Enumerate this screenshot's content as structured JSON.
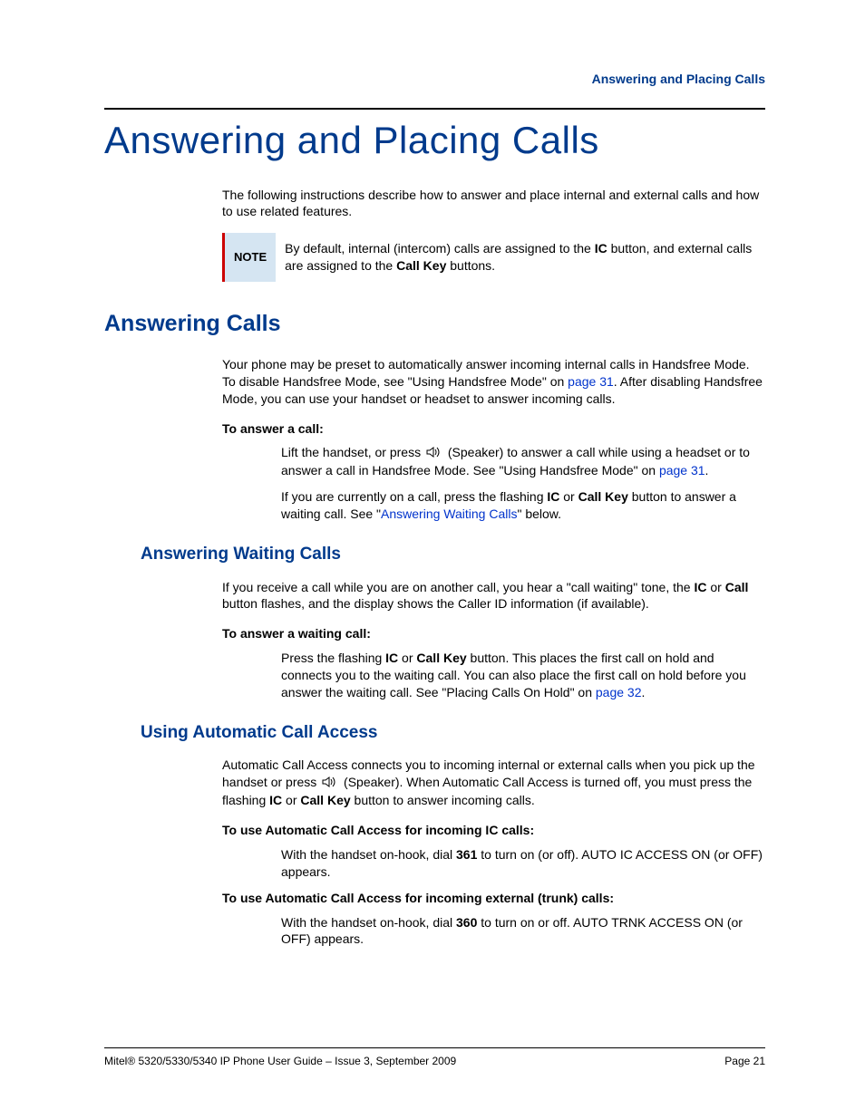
{
  "header": {
    "running": "Answering and Placing Calls"
  },
  "chapter": "Answering and Placing Calls",
  "intro": "The following instructions describe how to answer and place internal and external calls and how to use related features.",
  "note": {
    "label": "NOTE",
    "pre": "By default, internal (intercom) calls are assigned to the ",
    "b1": "IC",
    "mid": " button, and external calls are assigned to the ",
    "b2": "Call Key",
    "post": " buttons."
  },
  "s1": {
    "title": "Answering Calls",
    "p1a": "Your phone may be preset to automatically answer incoming internal calls in Handsfree Mode. To disable Handsfree Mode, see \"Using Handsfree Mode\" on ",
    "p1link": "page 31",
    "p1b": ". After disabling Handsfree Mode, you can use your handset or headset to answer incoming calls.",
    "sub": "To answer a call:",
    "l1a": "Lift the handset, or press ",
    "l1b": " (Speaker) to answer a call while using a headset or to answer a call in Handsfree Mode. See \"Using Handsfree Mode\" on ",
    "l1link": "page 31",
    "l1c": ".",
    "l2a": "If you are currently on a call, press the flashing ",
    "l2b1": "IC",
    "l2b": " or ",
    "l2b2": "Call Key",
    "l2c": " button to answer a waiting call. See \"",
    "l2link": "Answering Waiting Calls",
    "l2d": "\" below."
  },
  "s2": {
    "title": "Answering Waiting Calls",
    "p1a": "If you receive a call while you are on another call, you hear a \"call waiting\" tone, the ",
    "p1b1": "IC",
    "p1b": " or ",
    "p1b2": "Call",
    "p1c": " button flashes, and the display shows the Caller ID information (if available).",
    "sub": "To answer a waiting call:",
    "l1a": "Press the flashing ",
    "l1b1": "IC",
    "l1b": " or ",
    "l1b2": "Call Key",
    "l1c": " button. This places the first call on hold and connects you to the waiting call. You can also place the first call on hold before you answer the waiting call. See \"Placing Calls On Hold\" on ",
    "l1link": "page 32",
    "l1d": "."
  },
  "s3": {
    "title": "Using Automatic Call Access",
    "p1a": "Automatic Call Access connects you to incoming internal or external calls when you pick up the handset or press ",
    "p1b": " (Speaker). When Automatic Call Access is turned off, you must press the flashing ",
    "p1b1": "IC",
    "p1c": " or ",
    "p1b2": "Call Key",
    "p1d": " button to answer incoming calls.",
    "sub1": "To use Automatic Call Access for incoming IC calls:",
    "l1a": "With the handset on-hook, dial ",
    "l1b1": "361",
    "l1b": " to turn on (or off). AUTO IC ACCESS ON (or OFF) appears.",
    "sub2": "To use Automatic Call Access for incoming external (trunk) calls:",
    "l2a": "With the handset on-hook, dial ",
    "l2b1": "360",
    "l2b": " to turn on or off. AUTO TRNK ACCESS ON (or OFF) appears."
  },
  "footer": {
    "left": "Mitel® 5320/5330/5340 IP Phone User Guide  – Issue 3, September 2009",
    "right": "Page 21"
  }
}
